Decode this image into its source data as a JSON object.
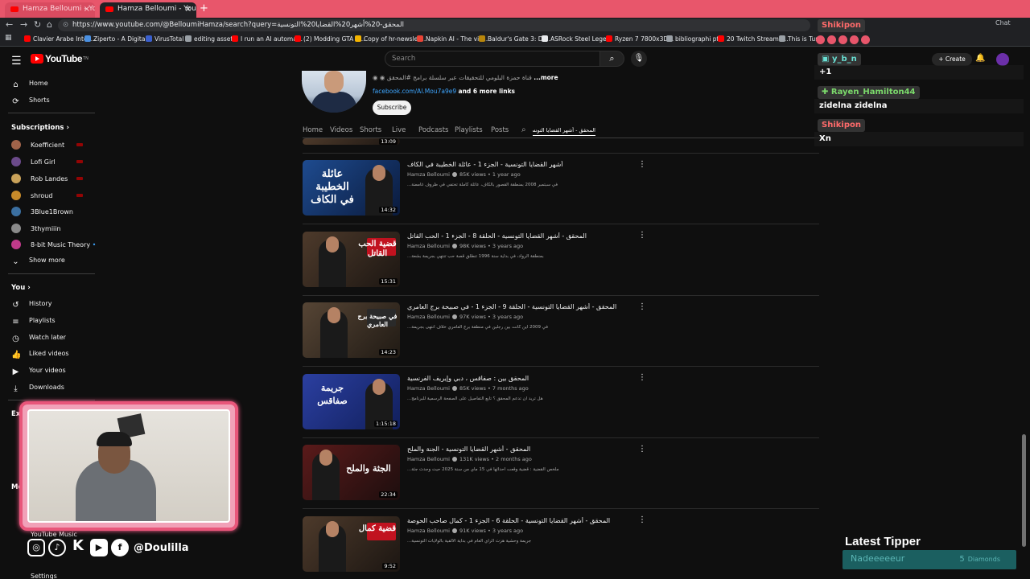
{
  "browser": {
    "tabs": [
      {
        "label": "Hamza Belloumi - YouTube",
        "active": false
      },
      {
        "label": "Hamza Belloumi - YouTube",
        "active": true
      }
    ],
    "url": "https://www.youtube.com/@BelloumiHamza/search?query=المحقق-20%أشهر20%القضايا20%التونسية",
    "bookmarks": [
      "Clavier Arabe Intell...",
      "Ziperto - A Digital...",
      "VirusTotal",
      "editing assets",
      "I run an AI automa...",
      "(2) Modding GTA S...",
      "Copy of hr-newslet...",
      "Napkin AI - The vis...",
      "Baldur's Gate 3: Di...",
      "ASRock Steel Lege...",
      "Ryzen 7 7800x3D...",
      "bibliographi pfe",
      "20 Twitch Stream I...",
      "This is Tur"
    ],
    "chat_label": "Chat"
  },
  "header": {
    "logo": "YouTube",
    "logo_sup": "TN",
    "search_placeholder": "Search",
    "create_label": "Create"
  },
  "sidebar": {
    "main": [
      {
        "label": "Home",
        "icon": "home-icon"
      },
      {
        "label": "Shorts",
        "icon": "shorts-icon"
      }
    ],
    "subscriptions_title": "Subscriptions",
    "subscriptions": [
      {
        "label": "Koefficient",
        "color": "#a0634a",
        "live": true
      },
      {
        "label": "Lofi Girl",
        "color": "#6b4a8a",
        "live": true
      },
      {
        "label": "Rob Landes",
        "color": "#c9a25a",
        "live": true
      },
      {
        "label": "shroud",
        "color": "#c78a2a",
        "live": true
      },
      {
        "label": "3Blue1Brown",
        "color": "#3b6fa0",
        "live": false
      },
      {
        "label": "3thymiiin",
        "color": "#8a8a8a",
        "live": false
      },
      {
        "label": "8-bit Music Theory",
        "color": "#c03a8a",
        "live": false
      }
    ],
    "show_more": "Show more",
    "you_title": "You",
    "you_items": [
      {
        "label": "History",
        "icon": "history-icon"
      },
      {
        "label": "Playlists",
        "icon": "playlists-icon"
      },
      {
        "label": "Watch later",
        "icon": "watch-later-icon"
      },
      {
        "label": "Liked videos",
        "icon": "like-icon"
      },
      {
        "label": "Your videos",
        "icon": "your-videos-icon"
      },
      {
        "label": "Downloads",
        "icon": "download-icon"
      }
    ],
    "explore_partial": "Ex",
    "more_partial": "Mo",
    "youtube_music": "YouTube Music",
    "settings_partial": "Settings"
  },
  "channel": {
    "description": "قناة حمزة البلومي للتحقيقات عبر سلسلة برامج #المحقق",
    "more": "...more",
    "link": "facebook.com/Al.Mou7a9e9",
    "more_links": "and 6 more links",
    "subscribe": "Subscribe",
    "tabs": [
      "Home",
      "Videos",
      "Shorts",
      "Live",
      "Podcasts",
      "Playlists",
      "Posts"
    ],
    "search_value": "المحقق - أشهر القضايا التونسية"
  },
  "partial_duration": "13:09",
  "videos": [
    {
      "title": "أشهر القضايا التونسية - الجزء 1 - عائلة الخطيبة في الكاف",
      "channel": "Hamza Belloumi",
      "views": "85K views",
      "age": "1 year ago",
      "desc": "في سبتمبر 2008 بمنطقة القصور بالكاف، عائلة كاملة تختفي في ظروف غامضة...",
      "duration": "14:32",
      "art": "عائلة الخطيبة في الكاف"
    },
    {
      "title": "المحقق - أشهر القضايا التونسية - الحلقة 8 - الجزء 1 - الحب القاتل",
      "channel": "Hamza Belloumi",
      "views": "98K views",
      "age": "3 years ago",
      "desc": "بمنطقة الرواد، في بداية سنة 1996 تنطلق قصة حب تنتهي بجريمة بشعة...",
      "duration": "15:31",
      "art": "قضية الحب القاتل"
    },
    {
      "title": "المحقق - أشهر القضايا التونسية - الحلقة 9 - الجزء 1 - في صبيحة برج العامري",
      "channel": "Hamza Belloumi",
      "views": "97K views",
      "age": "3 years ago",
      "desc": "في 2009 أين كانت بين رجلين في منطقة برج العامري خلاف انتهى بجريمة...",
      "duration": "14:23",
      "art": "في صبيحة برج العامري"
    },
    {
      "title": "المحقق بين : صفاقس ، دبي وإيريف الفرنسية",
      "channel": "Hamza Belloumi",
      "views": "85K views",
      "age": "7 months ago",
      "desc": "هل تريد أن تدعم المحقق ؟ تابع التفاصيل على الصفحة الرسمية للبرنامج...",
      "duration": "1:15:18",
      "art": "جريمة صفاقس"
    },
    {
      "title": "المحقق - أشهر القضايا التونسية - الجنة والملح",
      "channel": "Hamza Belloumi",
      "views": "131K views",
      "age": "2 months ago",
      "desc": "ملخص القضية : قضية وقعت أحداثها في 15 ماي من سنة 2025 حيث وجدت جثة...",
      "duration": "22:34",
      "art": "الجثة والملح"
    },
    {
      "title": "المحقق - أشهر القضايا التونسية - الحلقة 6 - الجزء 1 - كمال صاحب الحوصة",
      "channel": "Hamza Belloumi",
      "views": "91K views",
      "age": "3 years ago",
      "desc": "جريمة وحشية هزت الرأي العام في بداية الألفية بالولايات التونسية...",
      "duration": "9:52",
      "art": "قضية كمال"
    }
  ],
  "chat": [
    {
      "name": "Shikipon",
      "name_color": "#ff6b6b",
      "message": ""
    },
    {
      "name": "y_b_n",
      "name_color": "#69e0d4",
      "message": "+1"
    },
    {
      "name": "Rayen_Hamilton44",
      "name_color": "#7bd96b",
      "message": "zidelna zidelna"
    },
    {
      "name": "Shikipon",
      "name_color": "#ff6b6b",
      "message": "Xn"
    }
  ],
  "overlay": {
    "handle": "@Doulilla",
    "tipper_label": "Latest Tipper",
    "tipper_name": "Nadeeeeeur",
    "tipper_amount": "5",
    "tipper_unit": "Diamonds"
  }
}
